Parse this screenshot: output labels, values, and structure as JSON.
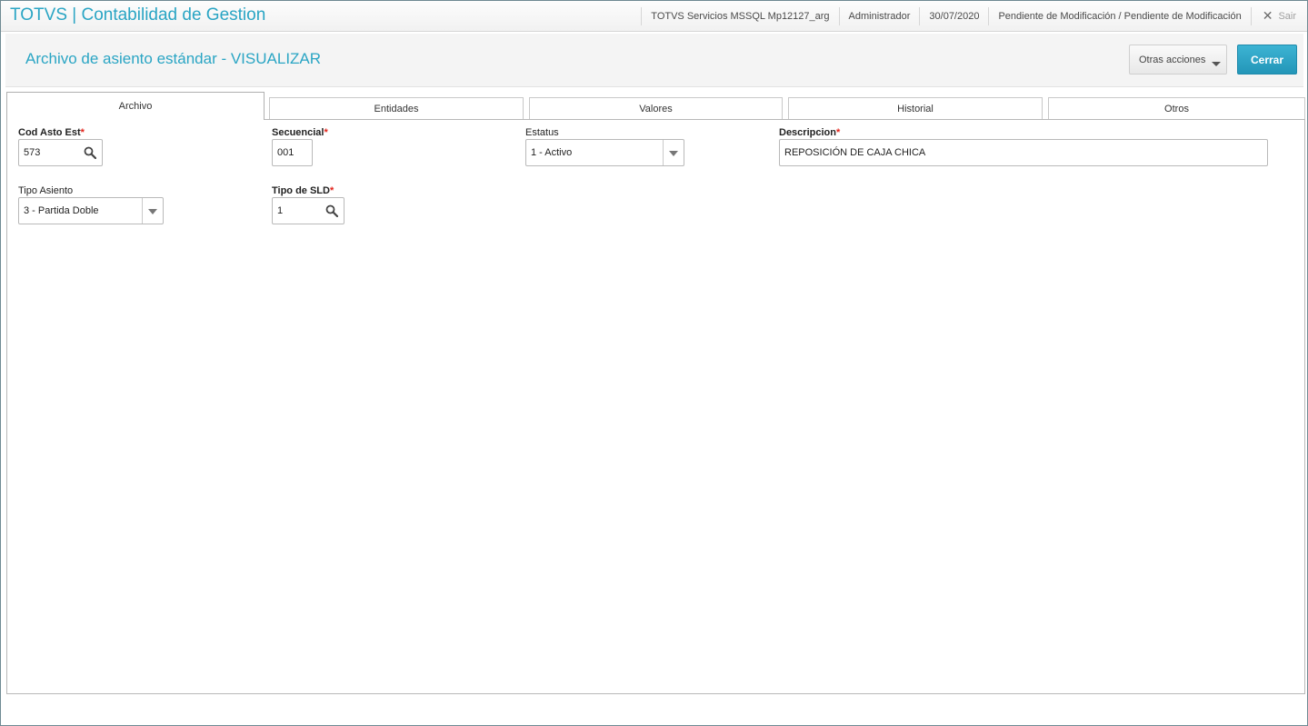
{
  "topbar": {
    "app_title": "TOTVS | Contabilidad de Gestion",
    "environment": "TOTVS Servicios MSSQL Mp12127_arg",
    "user": "Administrador",
    "date": "30/07/2020",
    "status": "Pendiente de Modificación / Pendiente de Modificación",
    "exit_label": "Sair"
  },
  "header": {
    "title": "Archivo de asiento estándar - VISUALIZAR",
    "other_actions_label": "Otras acciones",
    "close_label": "Cerrar"
  },
  "tabs": [
    {
      "label": "Archivo",
      "active": true
    },
    {
      "label": "Entidades"
    },
    {
      "label": "Valores"
    },
    {
      "label": "Historial"
    },
    {
      "label": "Otros"
    }
  ],
  "form": {
    "cod_asto_est": {
      "label": "Cod Asto Est",
      "value": "573",
      "required": "*"
    },
    "secuencial": {
      "label": "Secuencial",
      "value": "001",
      "required": "*"
    },
    "estatus": {
      "label": "Estatus",
      "value": "1 - Activo"
    },
    "descripcion": {
      "label": "Descripcion",
      "value": "REPOSICIÓN DE CAJA CHICA",
      "required": "*"
    },
    "tipo_asiento": {
      "label": "Tipo Asiento",
      "value": "3 - Partida Doble"
    },
    "tipo_sld": {
      "label": "Tipo de SLD",
      "value": "1",
      "required": "*"
    }
  },
  "colors": {
    "accent": "#2aa5c4",
    "required": "#e2231a",
    "primary_button": "#2396b8"
  }
}
